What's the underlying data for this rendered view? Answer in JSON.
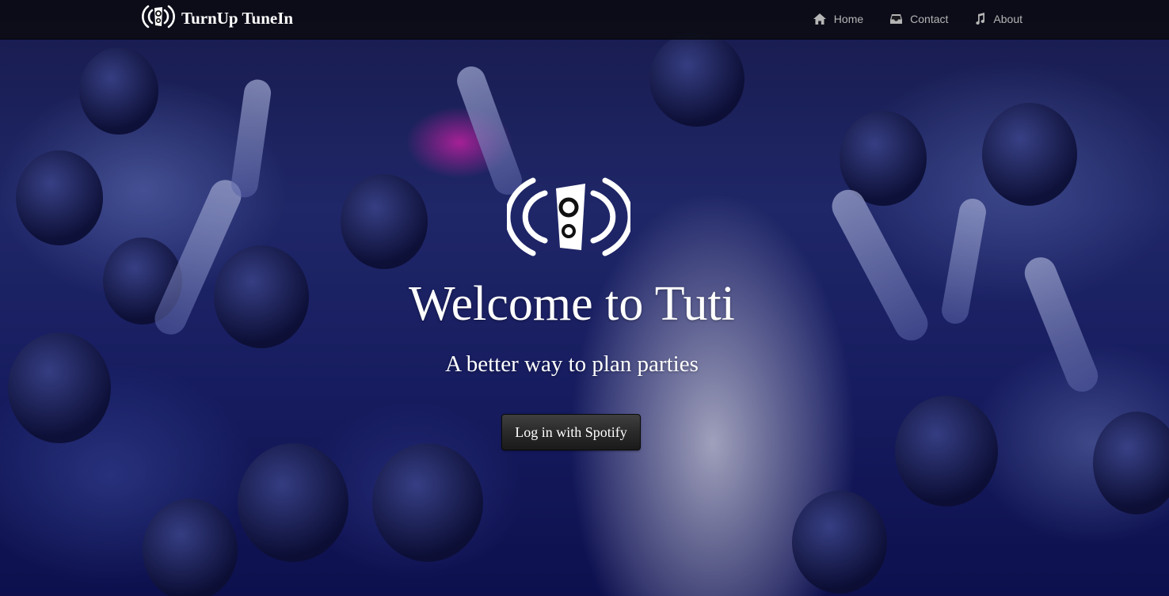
{
  "navbar": {
    "brand": "TurnUp TuneIn",
    "items": [
      {
        "label": "Home",
        "icon": "home-icon"
      },
      {
        "label": "Contact",
        "icon": "inbox-icon"
      },
      {
        "label": "About",
        "icon": "music-note-icon"
      }
    ]
  },
  "hero": {
    "logo_icon": "speaker-broadcast-icon",
    "title": "Welcome to Tuti",
    "subtitle": "A better way to plan parties",
    "login_button": "Log in with Spotify",
    "background": "concert-crowd-photo"
  },
  "colors": {
    "navbar_bg": "#0a0a0e",
    "nav_text": "#b5b5b5",
    "hero_text": "#ffffff",
    "button_bg": "#2a2a2a"
  }
}
